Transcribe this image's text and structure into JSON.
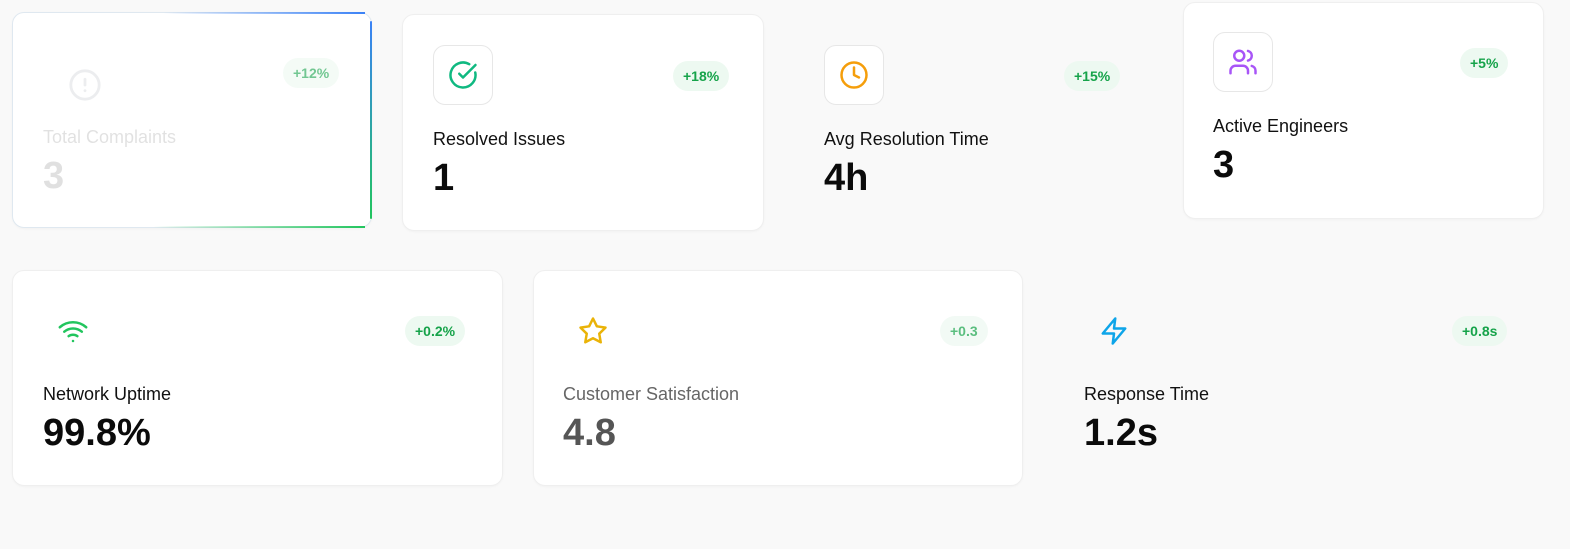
{
  "stats_top": [
    {
      "label": "Total Complaints",
      "value": "3",
      "change": "+12%",
      "icon": "alert-circle-icon",
      "color": "#9ca3af"
    },
    {
      "label": "Resolved Issues",
      "value": "1",
      "change": "+18%",
      "icon": "check-circle-icon",
      "color": "#10b981"
    },
    {
      "label": "Avg Resolution Time",
      "value": "4h",
      "change": "+15%",
      "icon": "clock-icon",
      "color": "#f59e0b"
    },
    {
      "label": "Active Engineers",
      "value": "3",
      "change": "+5%",
      "icon": "users-icon",
      "color": "#a855f7"
    }
  ],
  "stats_bottom": [
    {
      "label": "Network Uptime",
      "value": "99.8%",
      "change": "+0.2%",
      "icon": "wifi-icon",
      "color": "#22c55e"
    },
    {
      "label": "Customer Satisfaction",
      "value": "4.8",
      "change": "+0.3",
      "icon": "star-icon",
      "color": "#eab308"
    },
    {
      "label": "Response Time",
      "value": "1.2s",
      "change": "+0.8s",
      "icon": "zap-icon",
      "color": "#0ea5e9"
    }
  ],
  "colors": {
    "badge_text": "#16a34a",
    "badge_bg": "#edf9f1"
  }
}
